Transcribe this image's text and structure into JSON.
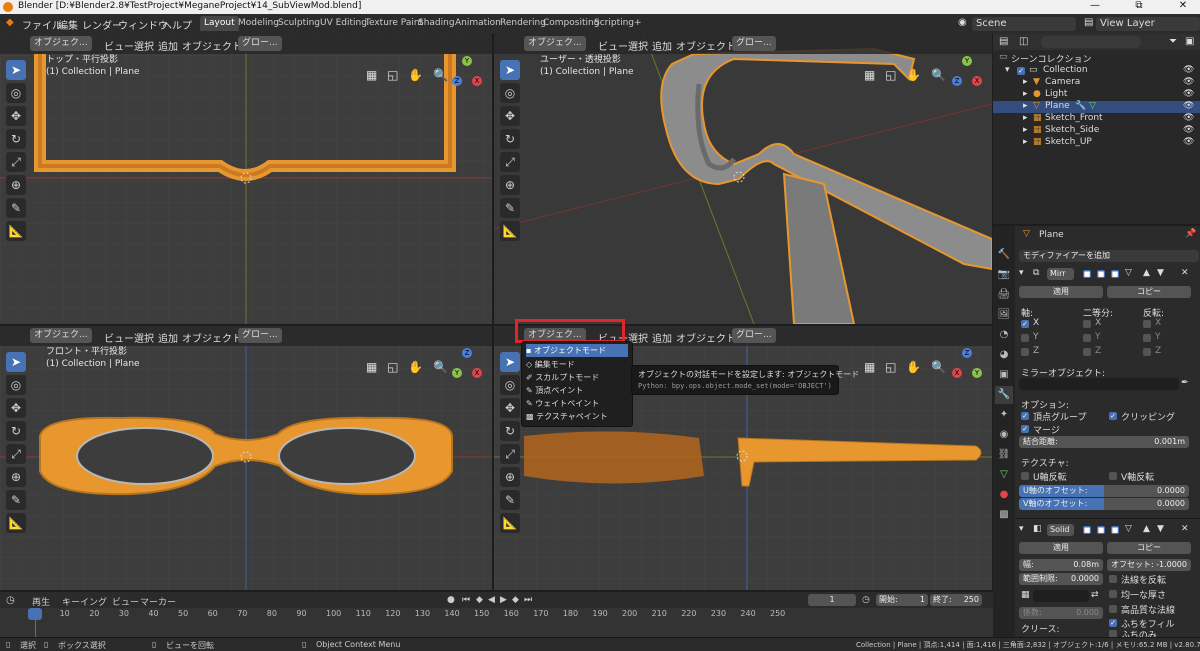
{
  "window": {
    "title": "Blender [D:¥Blender2.8¥TestProject¥MeganeProject¥14_SubViewMod.blend]",
    "minimize": "—",
    "maximize": "⧉",
    "close": "✕"
  },
  "menu": {
    "file": "ファイル",
    "edit": "編集",
    "render": "レンダー",
    "window": "ウィンドウ",
    "help": "ヘルプ"
  },
  "workspaces": [
    "Layout",
    "Modeling",
    "Sculpting",
    "UV Editing",
    "Texture Paint",
    "Shading",
    "Animation",
    "Rendering",
    "Compositing",
    "Scripting",
    "+"
  ],
  "scene": {
    "name": "Scene",
    "view_layer": "View Layer"
  },
  "viewport_header": {
    "mode": "オブジェク...",
    "view": "ビュー",
    "select": "選択",
    "add": "追加",
    "object": "オブジェクト",
    "transform": "グロー..."
  },
  "viewports": {
    "top": {
      "name": "トップ・平行投影",
      "collection": "(1) Collection | Plane"
    },
    "user": {
      "name": "ユーザー・透視投影",
      "collection": "(1) Collection | Plane"
    },
    "front": {
      "name": "フロント・平行投影",
      "collection": "(1) Collection | Plane"
    }
  },
  "mode_menu": {
    "items": [
      "オブジェクトモード",
      "編集モード",
      "スカルプトモード",
      "頂点ペイント",
      "ウェイトペイント",
      "テクスチャペイント"
    ],
    "tooltip": "オブジェクトの対話モードを設定します: オブジェクトモード",
    "python": "Python: bpy.ops.object.mode_set(mode='OBJECT')"
  },
  "outliner": {
    "root": "シーンコレクション",
    "items": [
      "Collection",
      "Camera",
      "Light",
      "Plane",
      "Sketch_Front",
      "Sketch_Side",
      "Sketch_UP"
    ]
  },
  "properties": {
    "object": "Plane",
    "add_modifier": "モディファイアーを追加",
    "mirror": {
      "name": "Mirr",
      "apply": "適用",
      "copy": "コピー",
      "axis": "軸:",
      "bisect": "二等分:",
      "flip": "反転:",
      "x": "X",
      "y": "Y",
      "z": "Z",
      "mirror_object": "ミラーオブジェクト:",
      "options": "オプション:",
      "vertex_groups": "頂点グループ",
      "clipping": "クリッピング",
      "merge": "マージ",
      "merge_distance": "結合距離:",
      "merge_distance_value": "0.001m",
      "textures": "テクスチャ:",
      "u_flip": "U軸反転",
      "v_flip": "V軸反転",
      "u_offset": "U軸のオフセット:",
      "u_offset_value": "0.0000",
      "v_offset": "V軸のオフセット:",
      "v_offset_value": "0.0000"
    },
    "solidify": {
      "name": "Solid",
      "apply": "適用",
      "copy": "コピー",
      "width": "幅:",
      "width_value": "0.08m",
      "offset": "オフセット:",
      "offset_value": "-1.0000",
      "clamp": "範囲制限:",
      "clamp_value": "0.0000",
      "factor": "係数:",
      "factor_value": "0.000",
      "crease": "クリース:",
      "flip_normals": "法線を反転",
      "even_thickness": "均一な厚さ",
      "high_quality_normals": "高品質な法線",
      "fill_rim": "ふちをフィル",
      "rim_only": "ふちのみ"
    }
  },
  "timeline": {
    "playback": "再生",
    "keying": "キーイング",
    "view": "ビュー",
    "marker": "マーカー",
    "current_frame": "1",
    "start_label": "開始:",
    "start": "1",
    "end_label": "終了:",
    "end": "250",
    "ticks": [
      "1",
      "10",
      "20",
      "30",
      "40",
      "50",
      "60",
      "70",
      "80",
      "90",
      "100",
      "110",
      "120",
      "130",
      "140",
      "150",
      "160",
      "170",
      "180",
      "190",
      "200",
      "210",
      "220",
      "230",
      "240",
      "250"
    ]
  },
  "status": {
    "select": "選択",
    "box_select": "ボックス選択",
    "rotate_view": "ビューを回転",
    "context_menu": "Object Context Menu",
    "stats": "Collection | Plane | 頂点:1,414 | 面:1,416 | 三角面:2,832 | オブジェクト:1/6 | メモリ:65.2 MB | v2.80.75"
  },
  "colors": {
    "accent": "#4772b3",
    "highlight_box": "#e0262a",
    "object_orange": "#e8972e",
    "viewport_bg": "#3d3d3d"
  }
}
